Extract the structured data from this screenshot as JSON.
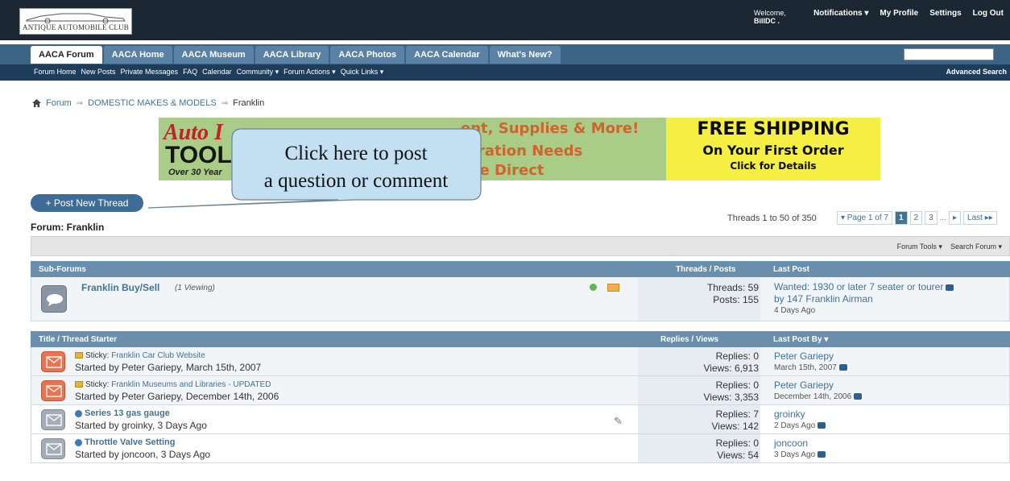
{
  "header": {
    "logo_text": "ANTIQUE AUTOMOBILE CLUB",
    "welcome": "Welcome,",
    "username": "BillDC .",
    "notifications": "Notifications ▾",
    "profile": "My Profile",
    "settings": "Settings",
    "logout": "Log Out"
  },
  "tabs": [
    {
      "label": "AACA Forum",
      "active": true
    },
    {
      "label": "AACA Home"
    },
    {
      "label": "AACA Museum"
    },
    {
      "label": "AACA Library"
    },
    {
      "label": "AACA Photos"
    },
    {
      "label": "AACA Calendar"
    },
    {
      "label": "What's New?"
    }
  ],
  "subnav": {
    "links": [
      "Forum Home",
      "New Posts",
      "Private Messages",
      "FAQ",
      "Calendar",
      "Community ▾",
      "Forum Actions ▾",
      "Quick Links ▾"
    ],
    "advanced_search": "Advanced Search"
  },
  "breadcrumb": {
    "home": "Forum",
    "category": "DOMESTIC MAKES & MODELS",
    "current": "Franklin"
  },
  "banner": {
    "logo_line1": "Auto I",
    "logo_line2": "TOOL",
    "years": "Over 30 Year",
    "mid_line1": "ent, Supplies & More!",
    "mid_line2": "toration Needs",
    "mid_line3": "use Direct",
    "free_line1": "FREE SHIPPING",
    "free_line2": "On Your First Order",
    "free_line3": "Click for Details"
  },
  "callout": {
    "line1": "Click here to post",
    "line2": "a question or comment"
  },
  "post_button": "+ Post New Thread",
  "forum_title": "Forum: Franklin",
  "threads_count": "Threads 1 to 50 of 350",
  "pager": {
    "page_of": "▾ Page 1 of 7",
    "pages": [
      "1",
      "2",
      "3"
    ],
    "ellipsis": "...",
    "next": "▸",
    "last": "Last ▸▸"
  },
  "tools": {
    "forum_tools": "Forum Tools ▾",
    "search_forum": "Search Forum ▾"
  },
  "subforums": {
    "header": {
      "title": "Sub-Forums",
      "stats": "Threads / Posts",
      "last": "Last Post"
    },
    "items": [
      {
        "name": "Franklin Buy/Sell",
        "viewing": "(1 Viewing)",
        "threads": "Threads: 59",
        "posts": "Posts: 155",
        "last_title": "Wanted: 1930 or later 7 seater or tourer",
        "last_by": "by 147 Franklin Airman",
        "last_date": "4 Days Ago"
      }
    ]
  },
  "threads": {
    "header": {
      "title": "Title / Thread Starter",
      "stats": "Replies / Views",
      "last": "Last Post By ▾"
    },
    "items": [
      {
        "prefix": "Sticky:",
        "title": "Franklin Car Club Website",
        "starter": "Started by Peter Gariepy, March 15th, 2007",
        "replies": "Replies: 0",
        "views": "Views: 6,913",
        "last_by": "Peter Gariepy",
        "last_date": "March 15th, 2007",
        "type": "sticky"
      },
      {
        "prefix": "Sticky:",
        "title": "Franklin Museums and Libraries - UPDATED",
        "starter": "Started by Peter Gariepy, December 14th, 2006",
        "replies": "Replies: 0",
        "views": "Views: 3,353",
        "last_by": "Peter Gariepy",
        "last_date": "December 14th, 2006",
        "type": "sticky"
      },
      {
        "prefix": "",
        "title": "Series 13 gas gauge",
        "starter": "Started by groinky, 3 Days Ago",
        "replies": "Replies: 7",
        "views": "Views: 142",
        "last_by": "groinky",
        "last_date": "2 Days Ago",
        "type": "normal",
        "attachment": true
      },
      {
        "prefix": "",
        "title": "Throttle Valve Setting",
        "starter": "Started by joncoon, 3 Days Ago",
        "replies": "Replies: 0",
        "views": "Views: 54",
        "last_by": "joncoon",
        "last_date": "3 Days Ago",
        "type": "normal"
      }
    ]
  },
  "colors": {
    "header_bg": "#1b2733",
    "tab_bar": "#3c6484",
    "subnav": "#1e3d5a",
    "section_head": "#6a8fad",
    "link": "#417394",
    "sticky_icon": "#e9724f",
    "normal_icon": "#8e9aa6"
  }
}
